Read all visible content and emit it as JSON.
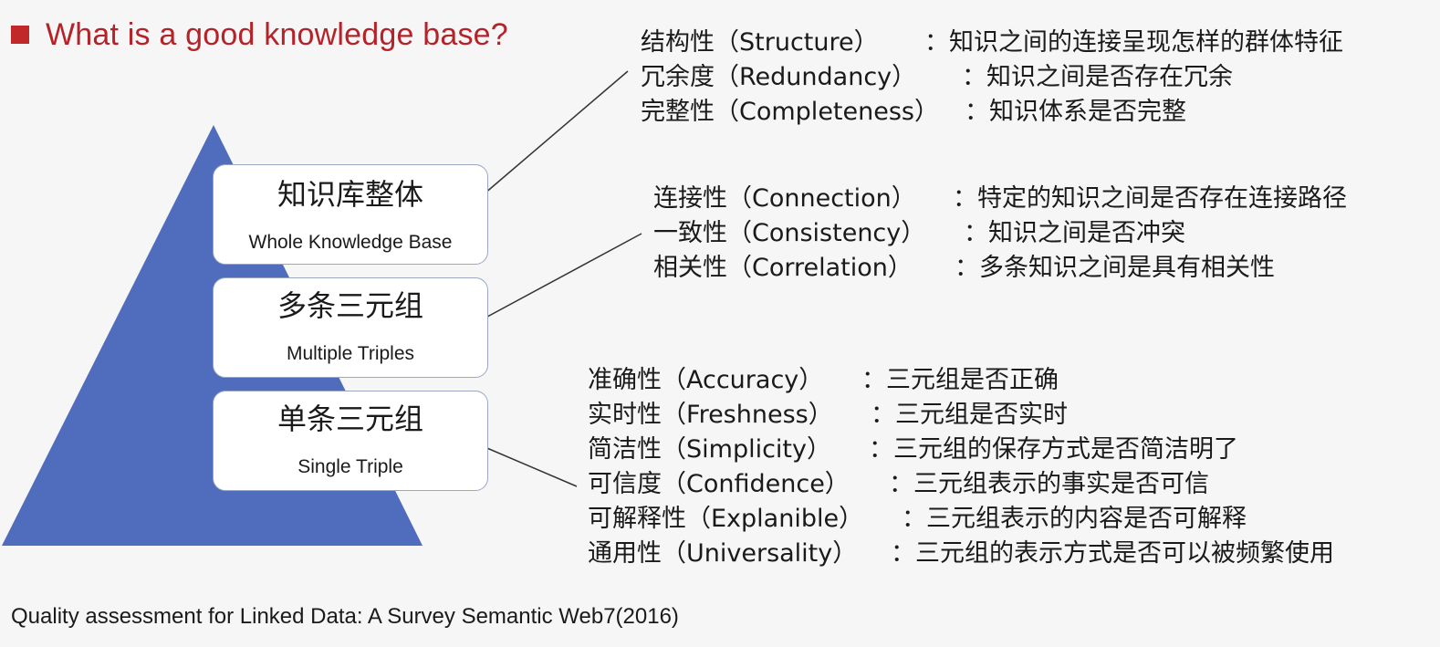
{
  "title": "What is a good knowledge base?",
  "colors": {
    "title": "#b4232a",
    "bullet": "#c0282a",
    "pyramid": "#4f6cbd",
    "box_border": "#9aa6c4"
  },
  "pyramid": {
    "levels": [
      {
        "zh": "知识库整体",
        "en": "Whole Knowledge Base"
      },
      {
        "zh": "多条三元组",
        "en": "Multiple Triples"
      },
      {
        "zh": "单条三元组",
        "en": "Single Triple"
      }
    ]
  },
  "groups": [
    {
      "items": [
        {
          "name": "结构性（Structure）",
          "desc": "：知识之间的连接呈现怎样的群体特征"
        },
        {
          "name": "冗余度（Redundancy）",
          "desc": "：知识之间是否存在冗余"
        },
        {
          "name": "完整性（Completeness）",
          "desc": "：知识体系是否完整"
        }
      ]
    },
    {
      "items": [
        {
          "name": "连接性（Connection）",
          "desc": "：特定的知识之间是否存在连接路径"
        },
        {
          "name": "一致性（Consistency）",
          "desc": "：知识之间是否冲突"
        },
        {
          "name": "相关性（Correlation）",
          "desc": "：多条知识之间是具有相关性"
        }
      ]
    },
    {
      "items": [
        {
          "name": "准确性（Accuracy）",
          "desc": "：三元组是否正确"
        },
        {
          "name": "实时性（Freshness）",
          "desc": "：三元组是否实时"
        },
        {
          "name": "简洁性（Simplicity）",
          "desc": "：三元组的保存方式是否简洁明了"
        },
        {
          "name": "可信度（Confidence）",
          "desc": "：三元组表示的事实是否可信"
        },
        {
          "name": "可解释性（Explanible）",
          "desc": "：三元组表示的内容是否可解释"
        },
        {
          "name": "通用性（Universality）",
          "desc": "：三元组的表示方式是否可以被频繁使用"
        }
      ]
    }
  ],
  "citation": "Quality assessment for Linked Data: A Survey  Semantic Web7(2016)"
}
